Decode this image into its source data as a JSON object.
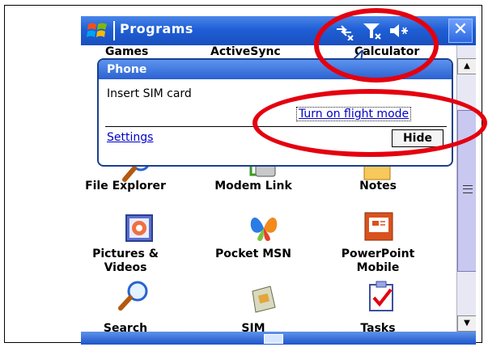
{
  "titlebar": {
    "title": "Programs",
    "icons": [
      "start-flag-icon",
      "connectivity-icon",
      "signal-icon",
      "volume-icon"
    ],
    "close_label": "✕"
  },
  "covered_row": [
    "Games",
    "ActiveSync",
    "Calculator"
  ],
  "bubble": {
    "title": "Phone",
    "message": "Insert SIM card",
    "flight_link": "Turn on flight mode",
    "settings_link": "Settings",
    "hide_button": "Hide"
  },
  "programs": [
    {
      "label": "File Explorer",
      "icon": "magnifier-icon"
    },
    {
      "label": "Modem Link",
      "icon": "modem-icon"
    },
    {
      "label": "Notes",
      "icon": "notes-icon"
    },
    {
      "label": "Pictures &\nVideos",
      "icon": "pictures-icon"
    },
    {
      "label": "Pocket MSN",
      "icon": "msn-butterfly-icon"
    },
    {
      "label": "PowerPoint\nMobile",
      "icon": "powerpoint-icon"
    },
    {
      "label": "Search",
      "icon": "search-icon"
    },
    {
      "label": "SIM",
      "icon": "sim-card-icon"
    },
    {
      "label": "Tasks",
      "icon": "tasks-icon"
    }
  ],
  "colors": {
    "accent_blue": "#1f5fd6",
    "highlight_red": "#e4000f",
    "link_blue": "#0000c8"
  }
}
